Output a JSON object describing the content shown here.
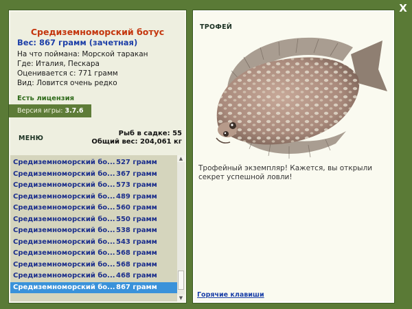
{
  "close_label": "X",
  "fish": {
    "name": "Средиземноморский ботус",
    "weight": "Вес: 867 грамм (зачетная)",
    "bait": "На что поймана: Морской таракан",
    "place": "Где: Италия, Пескара",
    "value": "Оценивается с: 771 грамм",
    "rarity": "Вид: Ловится очень редко"
  },
  "license": "Есть лицензия",
  "version": {
    "label": "Версия игры:",
    "number": "3.7.6"
  },
  "menu_label": "МЕНЮ",
  "stats": {
    "count": "Рыб в садке: 55",
    "total": "Общий вес: 204,061 кг"
  },
  "catch_list": [
    {
      "name": "Средиземноморский бо...",
      "weight": "527 грамм"
    },
    {
      "name": "Средиземноморский бо...",
      "weight": "367 грамм"
    },
    {
      "name": "Средиземноморский бо...",
      "weight": "573 грамм"
    },
    {
      "name": "Средиземноморский бо...",
      "weight": "489 грамм"
    },
    {
      "name": "Средиземноморский бо...",
      "weight": "560 грамм"
    },
    {
      "name": "Средиземноморский бо...",
      "weight": "550 грамм"
    },
    {
      "name": "Средиземноморский бо...",
      "weight": "538 грамм"
    },
    {
      "name": "Средиземноморский бо...",
      "weight": "543 грамм"
    },
    {
      "name": "Средиземноморский бо...",
      "weight": "568 грамм"
    },
    {
      "name": "Средиземноморский бо...",
      "weight": "568 грамм"
    },
    {
      "name": "Средиземноморский бо...",
      "weight": "468 грамм"
    },
    {
      "name": "Средиземноморский бо...",
      "weight": "867 грамм"
    }
  ],
  "selected_index": 11,
  "trophy_label": "ТРОФЕЙ",
  "trophy_text": "Трофейный экземпляр! Кажется, вы открыли секрет успешной ловли!",
  "hotkeys_label": "Горячие клавиши",
  "icons": {
    "close": "close-icon",
    "scroll_up": "arrow-up-icon",
    "scroll_down": "arrow-down-icon"
  },
  "colors": {
    "frame": "#5a7a36",
    "panel": "#eeefe0",
    "name": "#c4360e",
    "accent": "#1d3fa8",
    "selection": "#3a92da"
  }
}
